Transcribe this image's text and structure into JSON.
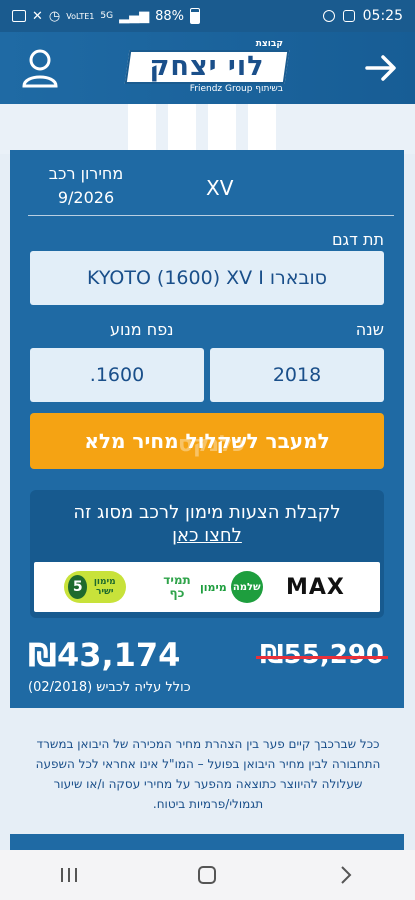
{
  "status_bar": {
    "battery": "88%",
    "network": "5G",
    "volte": "VoLTE1",
    "time": "05:25"
  },
  "header": {
    "logo_main": "לוי יצחק",
    "logo_top": "קבוצת",
    "logo_sub": "בשיתוף Friendz Group"
  },
  "car": {
    "price_list_label": "מחירון רכב",
    "price_list_date": "9/2026",
    "model_short": "XV",
    "submodel_label": "תת דגם",
    "submodel_value": "סובארו KYOTO (1600) XV I",
    "year_label": "שנה",
    "year_value": "2018",
    "engine_label": "נפח מנוע",
    "engine_value": "1600."
  },
  "cta": {
    "label": "למעבר לשקלול מחיר מלא"
  },
  "watermark": "כלנקס",
  "finance": {
    "title": "לקבלת הצעות מימון לרכב מסוג זה",
    "link": "לחצו כאן",
    "partners": {
      "max": "MAX",
      "shlomo_circle": "שלמה",
      "shlomo_text": "מימון",
      "tamid": "תמיד כף",
      "yashir_num": "5",
      "yashir_text": "מימון ישיר"
    }
  },
  "pricing": {
    "price_new": "₪43,174",
    "price_old": "₪55,290",
    "note": "כולל עליה לכביש (02/2018)"
  },
  "disclaimer": "ככל שברכבך קיים פער בין הצהרת מחיר המכירה של היבואן במשרד התחבורה לבין מחיר היבואן בפועל – המו\"ל אינו אחראי לכל השפעה שעלולה להיווצר כתוצאה מהפער על מחירי עסקה ו/או שיעור תגמולי/פרמיות ביטוח.",
  "colors": {
    "primary": "#1f6aa4",
    "accent": "#f5a313",
    "field_bg": "#e2eef8",
    "strike": "#e8303a"
  }
}
